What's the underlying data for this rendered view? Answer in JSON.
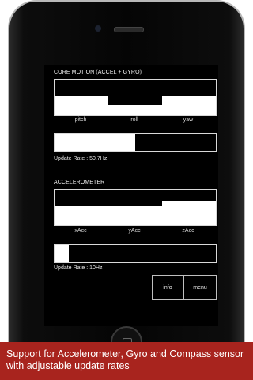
{
  "core_motion": {
    "title": "CORE MOTION (ACCEL + GYRO)",
    "labels": [
      "pitch",
      "roll",
      "yaw"
    ],
    "update_rate_text": "Update Rate : 50.7Hz",
    "update_rate_fraction": 0.5
  },
  "accelerometer": {
    "title": "ACCELEROMETER",
    "labels": [
      "xAcc",
      "yAcc",
      "zAcc"
    ],
    "update_rate_text": "Update Rate : 10Hz",
    "update_rate_fraction": 0.09
  },
  "buttons": {
    "info": "info",
    "menu": "menu"
  },
  "caption": "Support for Accelerometer, Gyro and Compass sensor with adjustable update rates",
  "colors": {
    "screen_bg": "#000000",
    "graph_fill": "#ffffff",
    "caption_bg": "#a8241e"
  }
}
